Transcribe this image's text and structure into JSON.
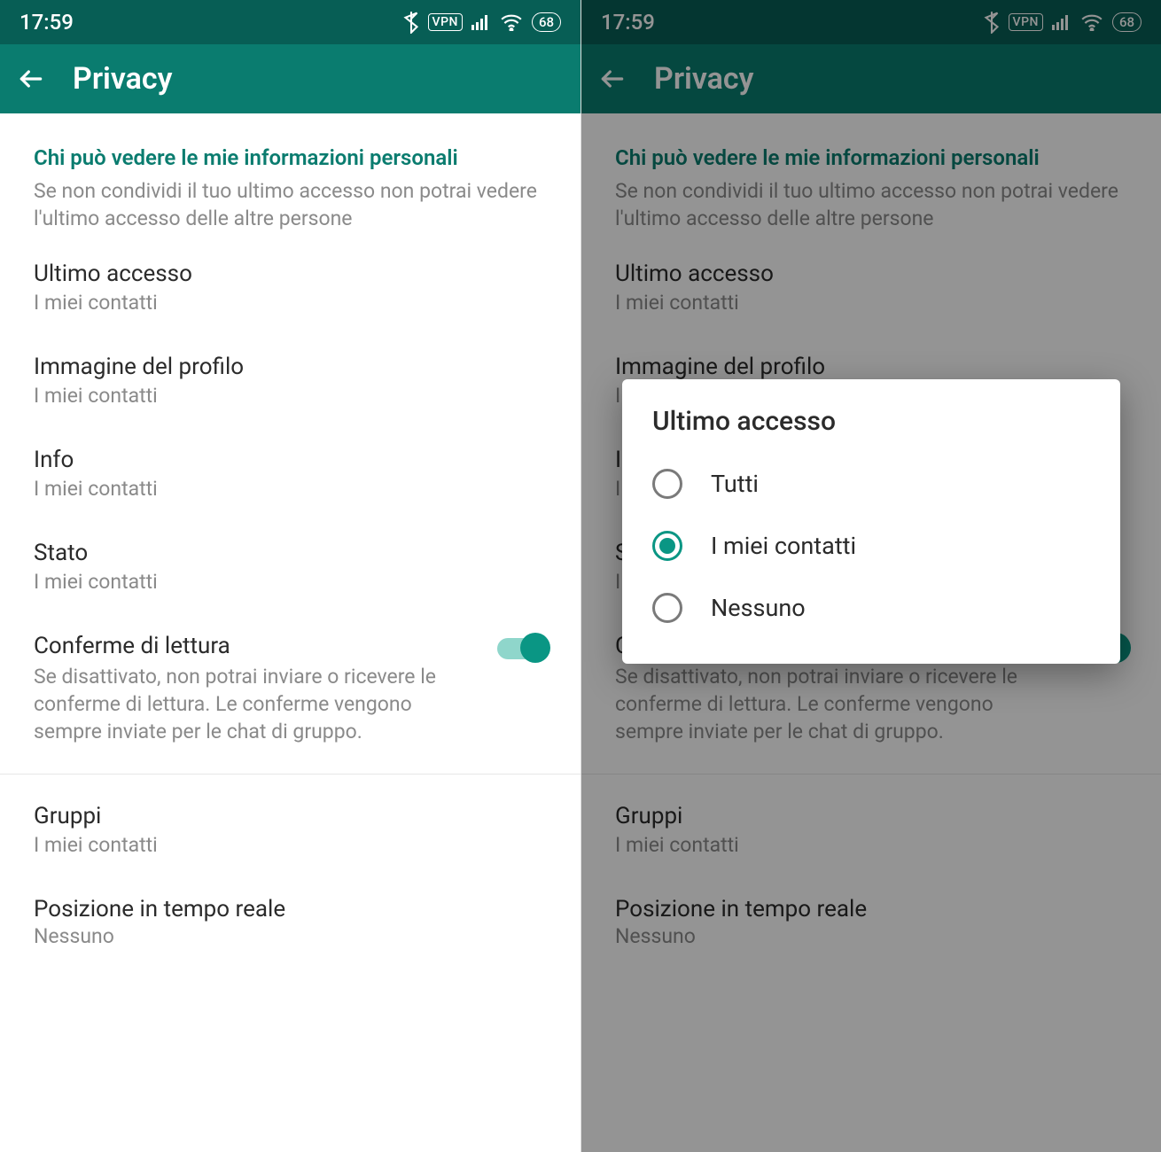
{
  "status": {
    "time": "17:59",
    "vpn": "VPN",
    "battery": "68"
  },
  "appbar": {
    "title": "Privacy"
  },
  "section": {
    "header": "Chi può vedere le mie informazioni personali",
    "desc": "Se non condividi il tuo ultimo accesso non potrai vedere l'ultimo accesso delle altre persone"
  },
  "items": {
    "last_seen": {
      "title": "Ultimo accesso",
      "value": "I miei contatti"
    },
    "profile_pic": {
      "title": "Immagine del profilo",
      "value": "I miei contatti"
    },
    "info": {
      "title": "Info",
      "value": "I miei contatti"
    },
    "status": {
      "title": "Stato",
      "value": "I miei contatti"
    },
    "read": {
      "title": "Conferme di lettura",
      "desc": "Se disattivato, non potrai inviare o ricevere le conferme di lettura. Le conferme vengono sempre inviate per le chat di gruppo."
    },
    "groups": {
      "title": "Gruppi",
      "value": "I miei contatti"
    },
    "live_loc": {
      "title": "Posizione in tempo reale",
      "value": "Nessuno"
    }
  },
  "dialog": {
    "title": "Ultimo accesso",
    "options": {
      "o0": "Tutti",
      "o1": "I miei contatti",
      "o2": "Nessuno"
    },
    "selected": 1
  }
}
